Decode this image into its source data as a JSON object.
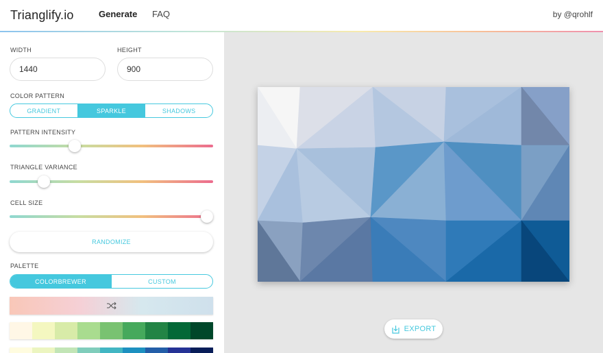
{
  "header": {
    "brand": "Trianglify.io",
    "nav": {
      "generate": "Generate",
      "faq": "FAQ"
    },
    "byline": "by @qrohlf"
  },
  "sidebar": {
    "width": {
      "label": "WIDTH",
      "value": "1440"
    },
    "height": {
      "label": "HEIGHT",
      "value": "900"
    },
    "color_pattern": {
      "label": "COLOR PATTERN",
      "options": [
        "GRADIENT",
        "SPARKLE",
        "SHADOWS"
      ],
      "selected": "SPARKLE"
    },
    "pattern_intensity": {
      "label": "PATTERN INTENSITY",
      "value": 0.32
    },
    "triangle_variance": {
      "label": "TRIANGLE VARIANCE",
      "value": 0.17
    },
    "cell_size": {
      "label": "CELL SIZE",
      "value": 0.97
    },
    "randomize_label": "RANDOMIZE",
    "palette": {
      "label": "PALETTE",
      "tabs": [
        "COLORBREWER",
        "CUSTOM"
      ],
      "selected": "COLORBREWER",
      "custom_colors": [
        "#f9c7b8",
        "#f5d0d6",
        "#d6e8ee",
        "#cfe0ec"
      ],
      "rows": [
        [
          "#fff7e6",
          "#f4f7c0",
          "#d8eba8",
          "#a9dc8f",
          "#79c271",
          "#46a95c",
          "#228445",
          "#036837",
          "#00472a"
        ],
        [
          "#fffcdf",
          "#ecf5c0",
          "#c2e5b6",
          "#80cdbb",
          "#42b6c3",
          "#1d90c0",
          "#235ea8",
          "#253295",
          "#081d58"
        ]
      ]
    }
  },
  "main": {
    "export_label": "EXPORT",
    "preview_colors": [
      "#f6f6f6",
      "#dcdfe8",
      "#c9d3e5",
      "#b4c7e0",
      "#9fb9d9",
      "#86a7cc",
      "#7287aa",
      "#5f7799",
      "#4f8fc1",
      "#2f7ab8",
      "#1a69a8",
      "#0f5b96",
      "#0b4e85",
      "#08467b"
    ]
  },
  "colors": {
    "accent": "#45c8de",
    "background_main": "#e6e6e6"
  }
}
